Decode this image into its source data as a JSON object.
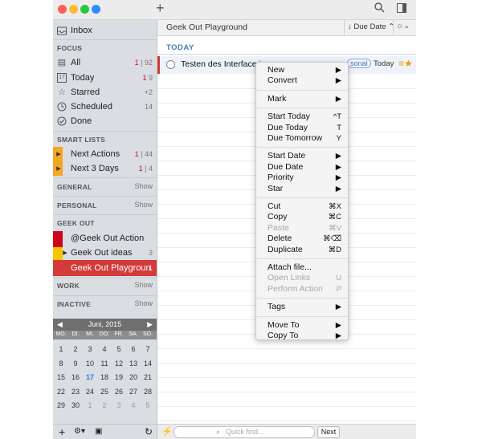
{
  "window": {
    "add_button": "+"
  },
  "sidebar": {
    "inbox": "Inbox",
    "focus_header": "FOCUS",
    "focus": [
      {
        "label": "All",
        "count_red": "1",
        "count": "| 92",
        "icon": "stack-icon"
      },
      {
        "label": "Today",
        "count_red": "1",
        "count": "9",
        "icon": "calendar-17-icon"
      },
      {
        "label": "Starred",
        "count_red": "",
        "count": "+2",
        "icon": "star-icon"
      },
      {
        "label": "Scheduled",
        "count_red": "",
        "count": "14",
        "icon": "clock-icon"
      },
      {
        "label": "Done",
        "count_red": "",
        "count": "",
        "icon": "check-circle-icon"
      }
    ],
    "smart_header": "SMART LISTS",
    "smart": [
      {
        "label": "Next Actions",
        "count_red": "1",
        "count": "| 44"
      },
      {
        "label": "Next 3 Days",
        "count_red": "1",
        "count": "| 4"
      }
    ],
    "groups": [
      {
        "label": "GENERAL",
        "show": "Show"
      },
      {
        "label": "PERSONAL",
        "show": "Show"
      }
    ],
    "geek_header": "GEEK OUT",
    "geek": [
      {
        "label": "@Geek Out Action",
        "count": ""
      },
      {
        "label": "Geek Out ideas",
        "count": "3"
      },
      {
        "label": "Geek Out Playgroun",
        "count": "1"
      }
    ],
    "groups2": [
      {
        "label": "WORK",
        "show": "Show"
      },
      {
        "label": "INACTIVE",
        "show": "Show"
      }
    ],
    "calendar": {
      "month": "Juni, 2015",
      "days": [
        "MO.",
        "DI.",
        "MI.",
        "DO.",
        "FR.",
        "SA.",
        "SO."
      ],
      "weeks": [
        [
          "1",
          "2",
          "3",
          "4",
          "5",
          "6",
          "7"
        ],
        [
          "8",
          "9",
          "10",
          "11",
          "12",
          "13",
          "14"
        ],
        [
          "15",
          "16",
          "17",
          "18",
          "19",
          "20",
          "21"
        ],
        [
          "22",
          "23",
          "24",
          "25",
          "26",
          "27",
          "28"
        ],
        [
          "29",
          "30",
          "1",
          "2",
          "3",
          "4",
          "5"
        ]
      ],
      "today": "17"
    }
  },
  "main": {
    "list_title": "Geek Out Playground",
    "sort_label": "Due Date",
    "section": "TODAY",
    "task": {
      "title": "Testen des Interface in",
      "tag": "sonal",
      "date": "Today"
    },
    "find_placeholder": "Quick find...",
    "next_button": "Next"
  },
  "menu": {
    "groups": [
      [
        {
          "label": "New",
          "shortcut": "▶"
        },
        {
          "label": "Convert",
          "shortcut": "▶"
        }
      ],
      [
        {
          "label": "Mark",
          "shortcut": "▶"
        }
      ],
      [
        {
          "label": "Start Today",
          "shortcut": "^T"
        },
        {
          "label": "Due Today",
          "shortcut": "T"
        },
        {
          "label": "Due Tomorrow",
          "shortcut": "Y"
        }
      ],
      [
        {
          "label": "Start Date",
          "shortcut": "▶"
        },
        {
          "label": "Due Date",
          "shortcut": "▶"
        },
        {
          "label": "Priority",
          "shortcut": "▶"
        },
        {
          "label": "Star",
          "shortcut": "▶"
        }
      ],
      [
        {
          "label": "Cut",
          "shortcut": "⌘X"
        },
        {
          "label": "Copy",
          "shortcut": "⌘C"
        },
        {
          "label": "Paste",
          "shortcut": "⌘V",
          "disabled": true
        },
        {
          "label": "Delete",
          "shortcut": "⌘⌫"
        },
        {
          "label": "Duplicate",
          "shortcut": "⌘D"
        }
      ],
      [
        {
          "label": "Attach file...",
          "shortcut": ""
        },
        {
          "label": "Open Links",
          "shortcut": "U",
          "disabled": true
        },
        {
          "label": "Perform Action",
          "shortcut": "P",
          "disabled": true
        }
      ],
      [
        {
          "label": "Tags",
          "shortcut": "▶"
        }
      ],
      [
        {
          "label": "Move To",
          "shortcut": "▶"
        },
        {
          "label": "Copy To",
          "shortcut": "▶"
        }
      ]
    ]
  }
}
